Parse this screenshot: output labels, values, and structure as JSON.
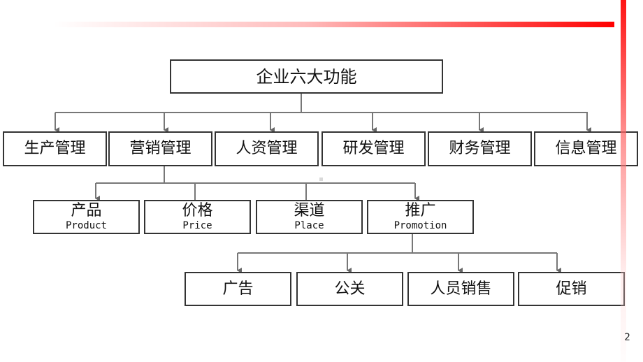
{
  "slide": {
    "page_number": "2",
    "accent_color": "#ff0000"
  },
  "root": {
    "label": "企业六大功能"
  },
  "functions": [
    {
      "label": "生产管理"
    },
    {
      "label": "营销管理"
    },
    {
      "label": "人资管理"
    },
    {
      "label": "研发管理"
    },
    {
      "label": "财务管理"
    },
    {
      "label": "信息管理"
    }
  ],
  "marketing_mix": [
    {
      "label": "产品",
      "english": "Product"
    },
    {
      "label": "价格",
      "english": "Price"
    },
    {
      "label": "渠道",
      "english": "Place"
    },
    {
      "label": "推广",
      "english": "Promotion"
    }
  ],
  "promotion_tools": [
    {
      "label": "广告"
    },
    {
      "label": "公关"
    },
    {
      "label": "人员销售"
    },
    {
      "label": "促销"
    }
  ]
}
